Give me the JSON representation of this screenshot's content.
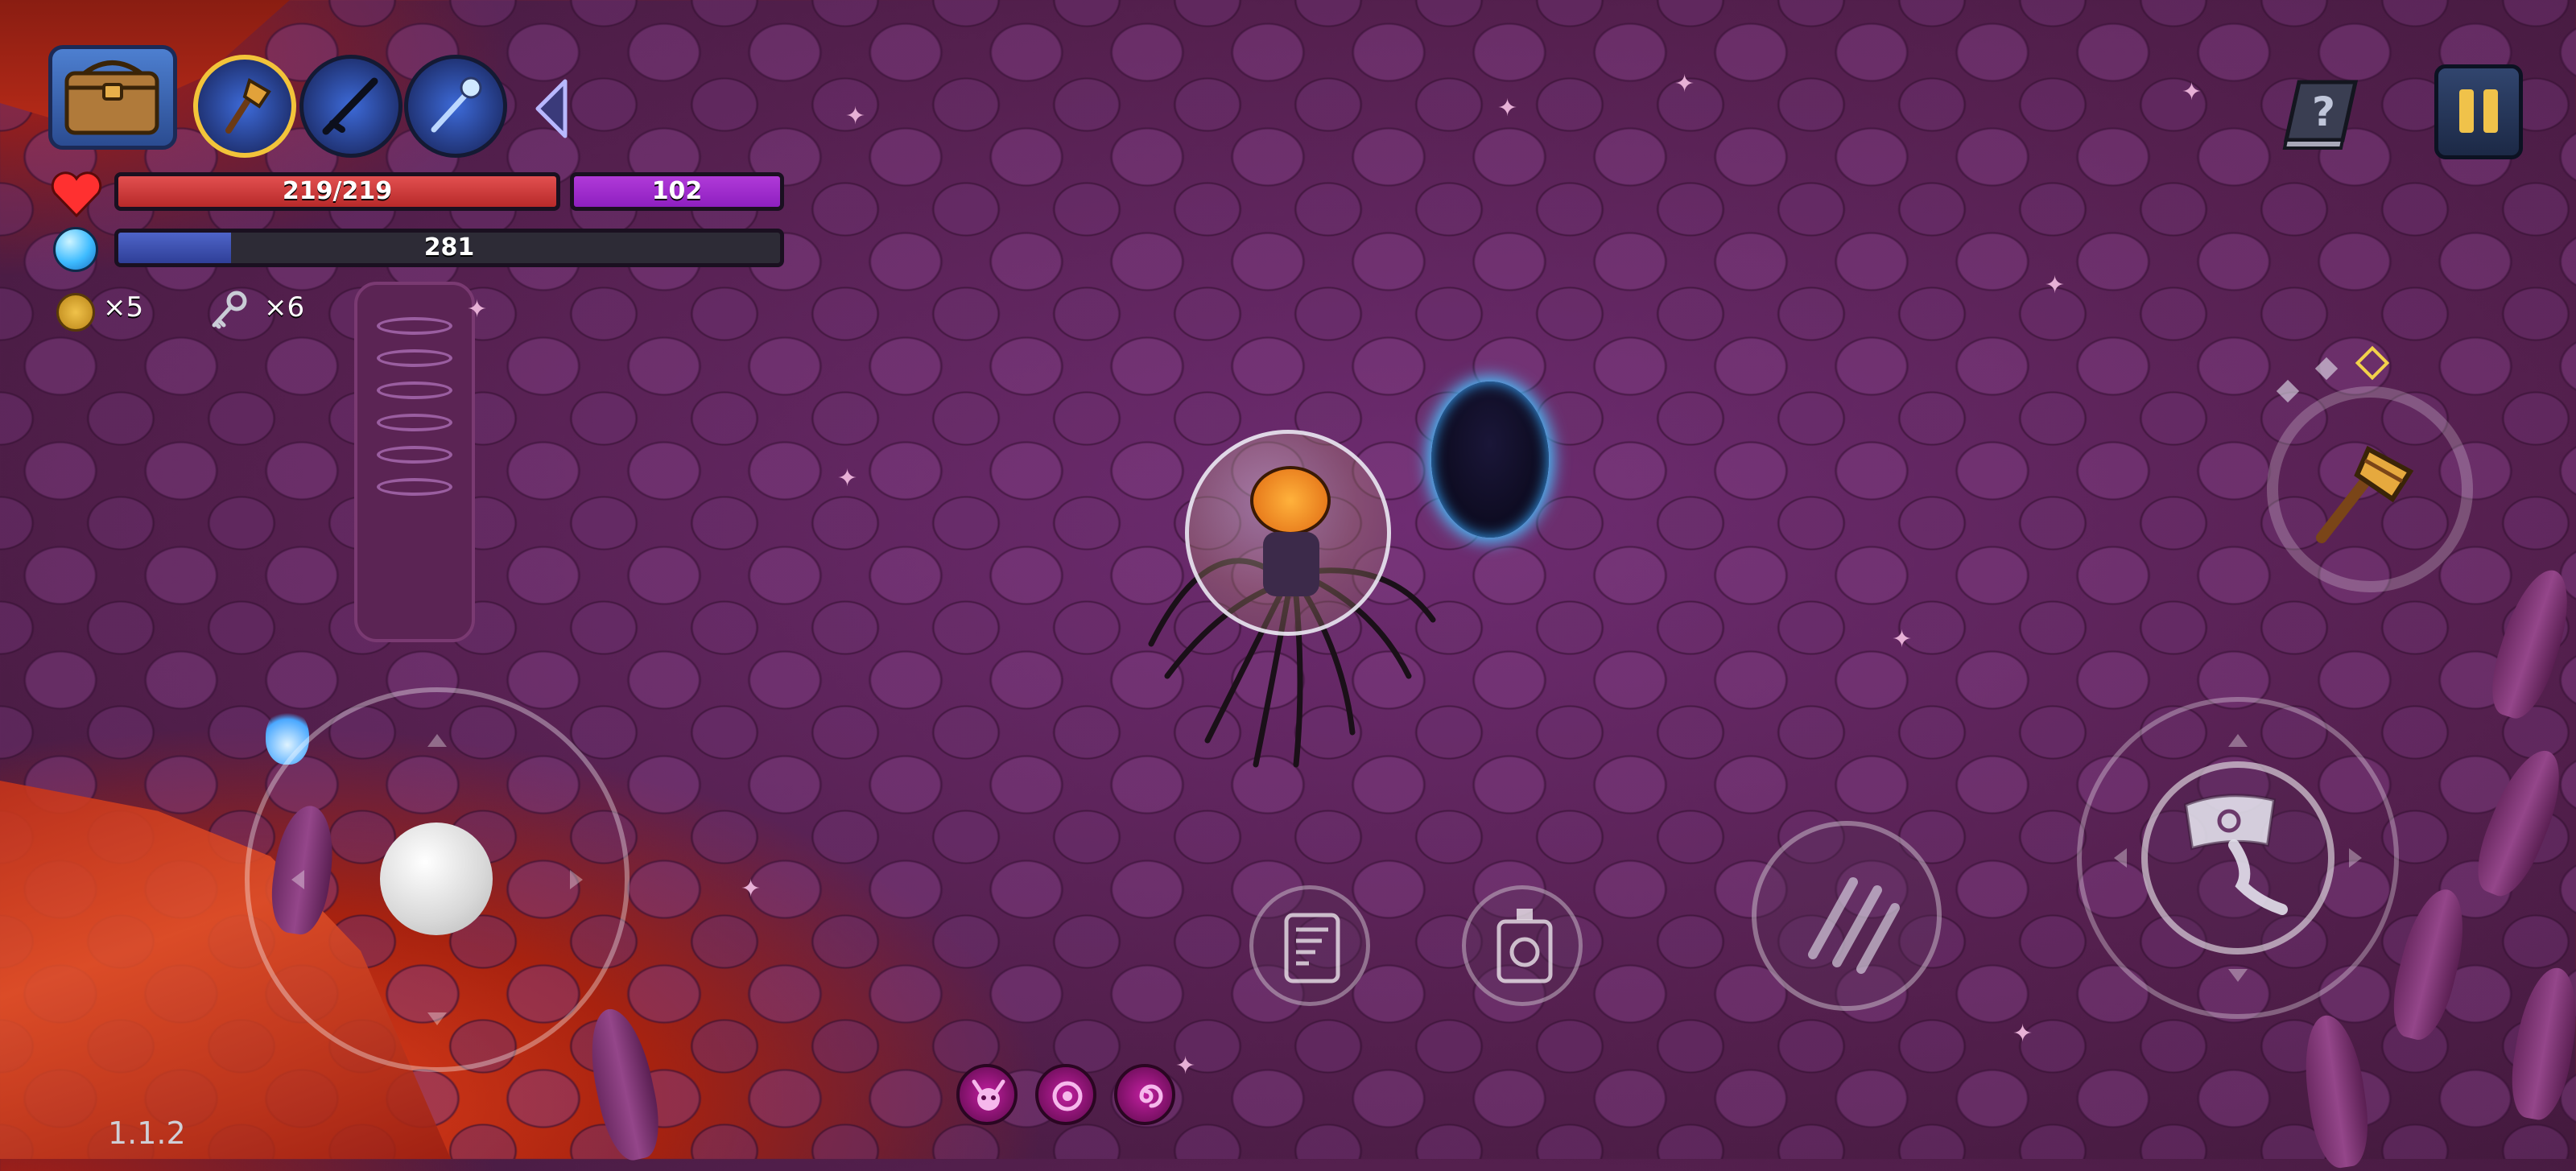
{
  "hud": {
    "hp_text": "219/219",
    "hp_current": 219,
    "hp_max": 219,
    "armor_text": "102",
    "mana_text": "281",
    "mana_fill_fraction": 0.17,
    "coins_text": "×5",
    "keys_text": "×6",
    "weapons": [
      {
        "name": "broom-icon",
        "active": true
      },
      {
        "name": "rifle-icon",
        "active": false
      },
      {
        "name": "ice-staff-icon",
        "active": false
      }
    ]
  },
  "controls": {
    "weapon_slot_indicators": 3,
    "active_weapon_indicator": 3
  },
  "buffs": [
    "demon-skull-icon",
    "vortex-eye-icon",
    "spiral-orb-icon"
  ],
  "version": "1.1.2",
  "colors": {
    "hp": "#d93a3a",
    "armor": "#9b27cc",
    "mana": "#3a4cad",
    "accent": "#f2c43a"
  }
}
